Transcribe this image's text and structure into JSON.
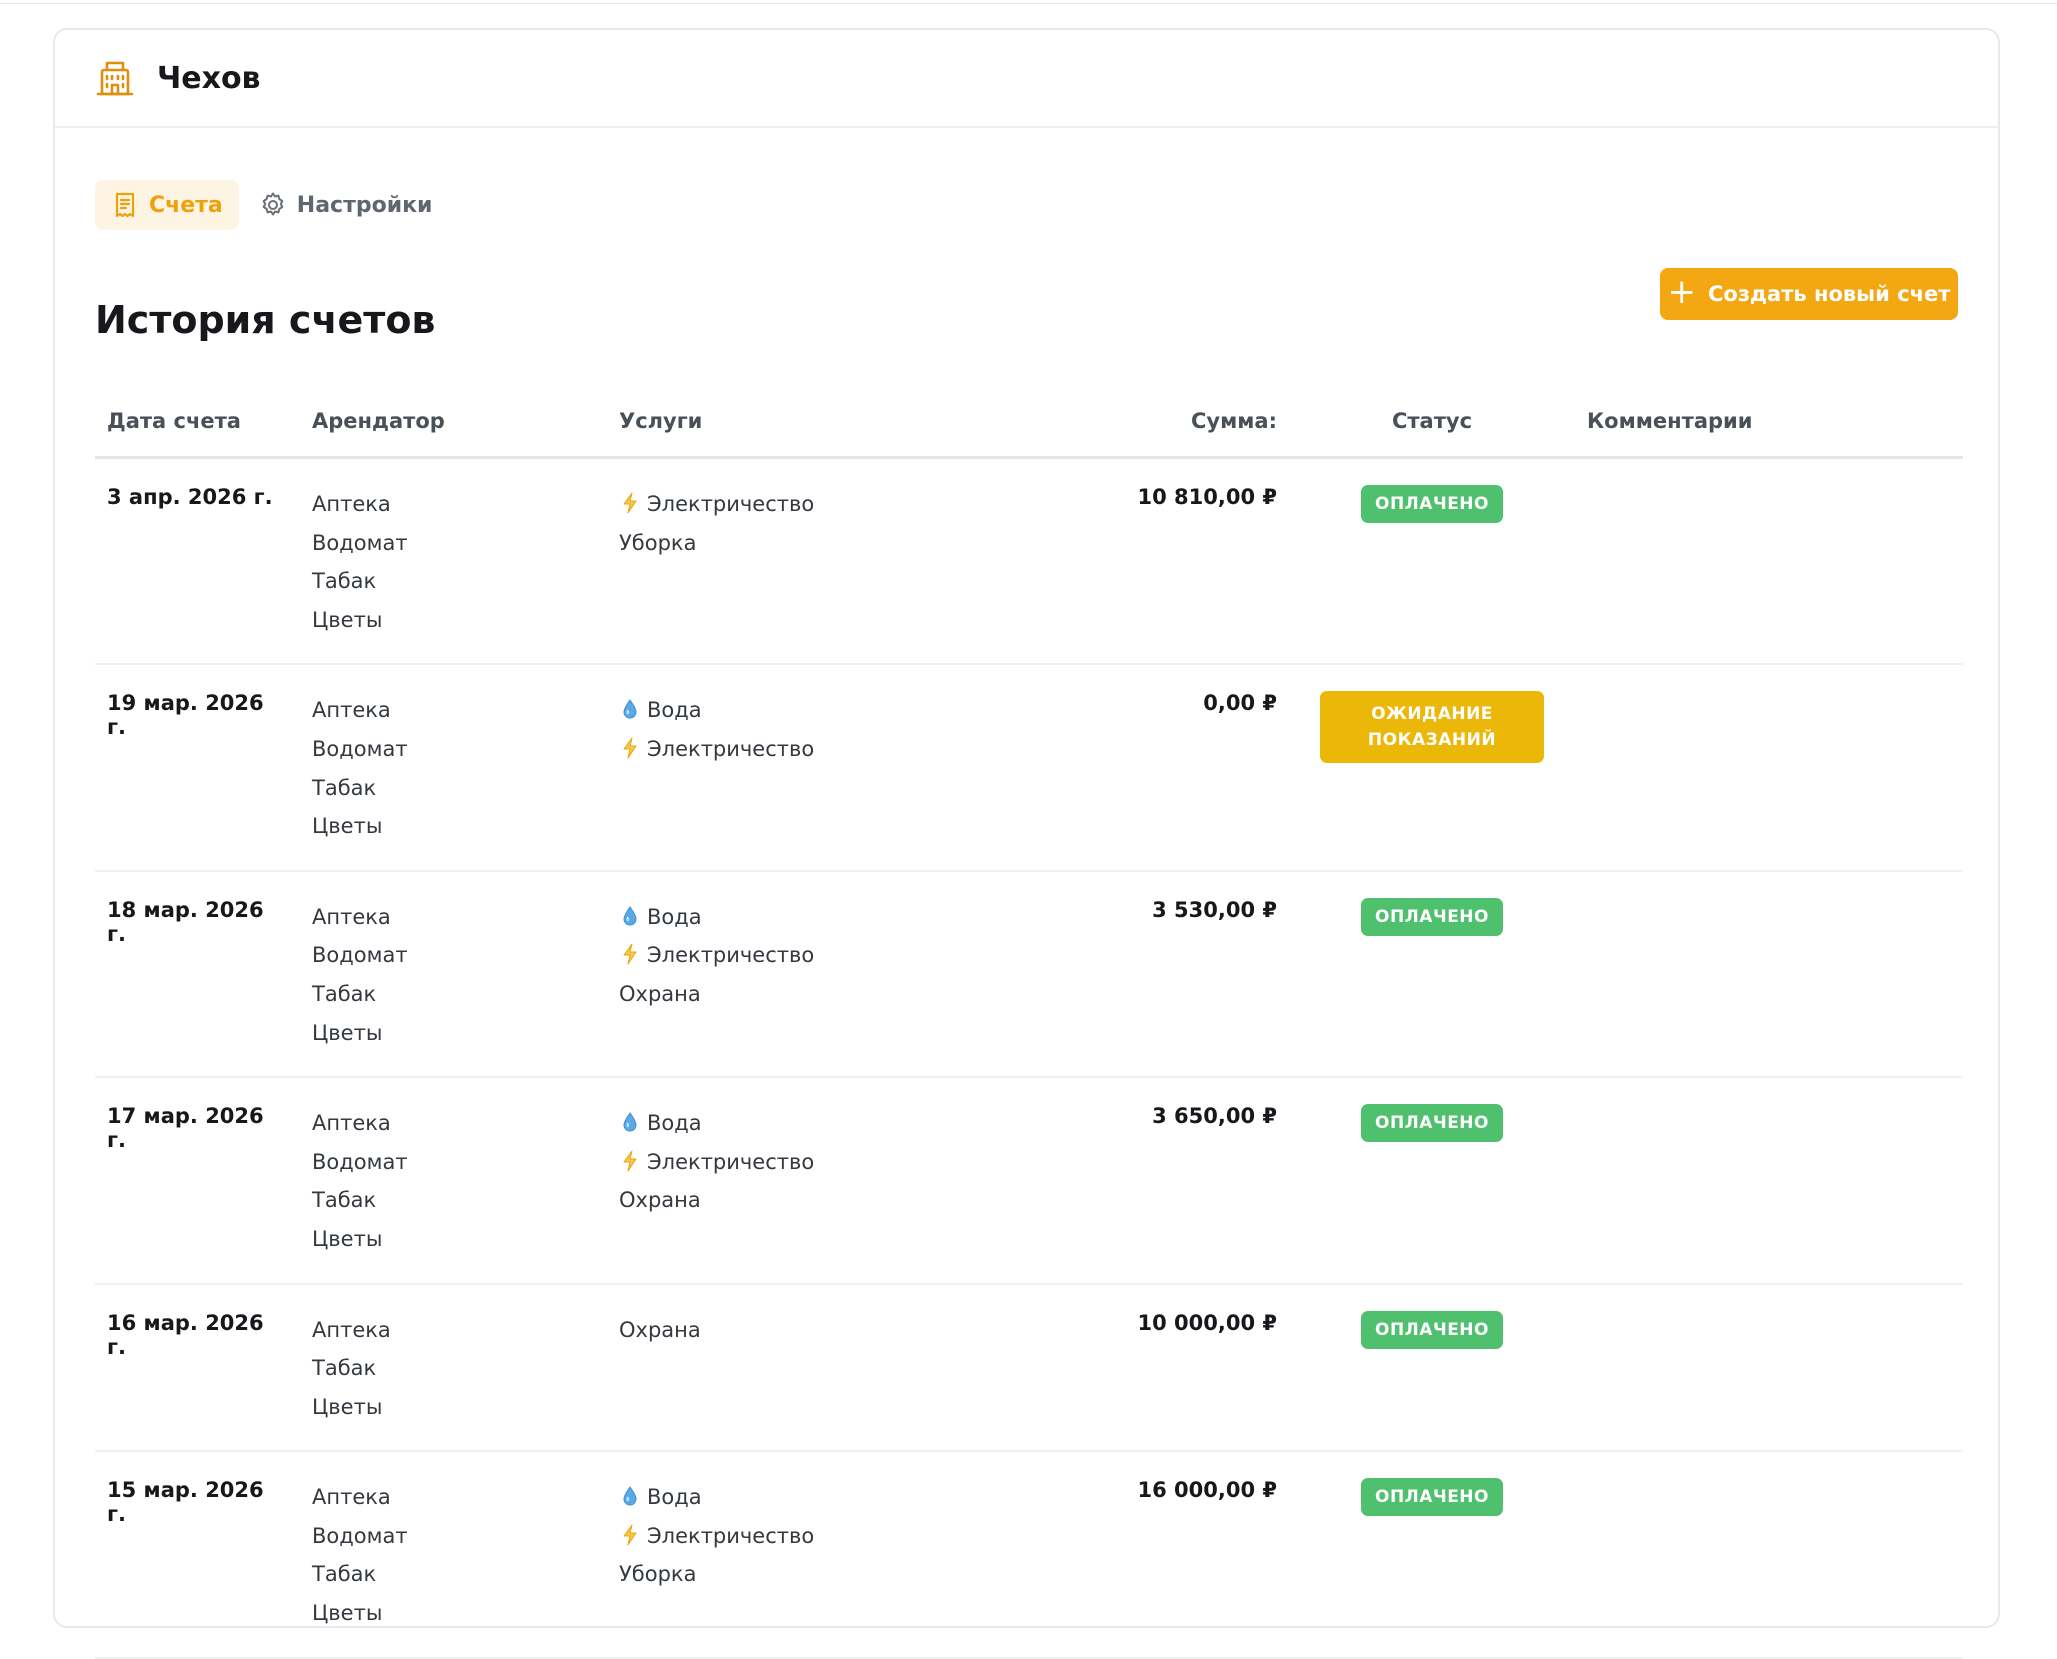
{
  "header": {
    "title": "Чехов",
    "icon": "building-icon"
  },
  "tabs": [
    {
      "label": "Счета",
      "icon": "receipt-icon",
      "active": true
    },
    {
      "label": "Настройки",
      "icon": "gear-icon",
      "active": false
    }
  ],
  "section": {
    "title": "История счетов"
  },
  "toolbar": {
    "create_label": "Создать новый счет",
    "create_icon": "plus-icon"
  },
  "colors": {
    "accent": "#f3a712",
    "paid": "#4fc06d",
    "pending": "#ebb80a"
  },
  "table": {
    "columns": [
      "Дата счета",
      "Арендатор",
      "Услуги",
      "Сумма:",
      "Статус",
      "Комментарии"
    ],
    "rows": [
      {
        "date": "3 апр. 2026 г.",
        "tenants": [
          "Аптека",
          "Водомат",
          "Табак",
          "Цветы"
        ],
        "services": [
          {
            "name": "Электричество",
            "icon": "lightning-icon"
          },
          {
            "name": "Уборка",
            "icon": ""
          }
        ],
        "amount": "10 810,00 ₽",
        "status": "ОПЛАЧЕНО",
        "status_type": "paid",
        "comment": ""
      },
      {
        "date": "19 мар. 2026 г.",
        "tenants": [
          "Аптека",
          "Водомат",
          "Табак",
          "Цветы"
        ],
        "services": [
          {
            "name": "Вода",
            "icon": "water-drop-icon"
          },
          {
            "name": "Электричество",
            "icon": "lightning-icon"
          }
        ],
        "amount": "0,00 ₽",
        "status": "ОЖИДАНИЕ ПОКАЗАНИЙ",
        "status_type": "pending",
        "comment": ""
      },
      {
        "date": "18 мар. 2026 г.",
        "tenants": [
          "Аптека",
          "Водомат",
          "Табак",
          "Цветы"
        ],
        "services": [
          {
            "name": "Вода",
            "icon": "water-drop-icon"
          },
          {
            "name": "Электричество",
            "icon": "lightning-icon"
          },
          {
            "name": "Охрана",
            "icon": ""
          }
        ],
        "amount": "3 530,00 ₽",
        "status": "ОПЛАЧЕНО",
        "status_type": "paid",
        "comment": ""
      },
      {
        "date": "17 мар. 2026 г.",
        "tenants": [
          "Аптека",
          "Водомат",
          "Табак",
          "Цветы"
        ],
        "services": [
          {
            "name": "Вода",
            "icon": "water-drop-icon"
          },
          {
            "name": "Электричество",
            "icon": "lightning-icon"
          },
          {
            "name": "Охрана",
            "icon": ""
          }
        ],
        "amount": "3 650,00 ₽",
        "status": "ОПЛАЧЕНО",
        "status_type": "paid",
        "comment": ""
      },
      {
        "date": "16 мар. 2026 г.",
        "tenants": [
          "Аптека",
          "Табак",
          "Цветы"
        ],
        "services": [
          {
            "name": "Охрана",
            "icon": ""
          }
        ],
        "amount": "10 000,00 ₽",
        "status": "ОПЛАЧЕНО",
        "status_type": "paid",
        "comment": ""
      },
      {
        "date": "15 мар. 2026 г.",
        "tenants": [
          "Аптека",
          "Водомат",
          "Табак",
          "Цветы"
        ],
        "services": [
          {
            "name": "Вода",
            "icon": "water-drop-icon"
          },
          {
            "name": "Электричество",
            "icon": "lightning-icon"
          },
          {
            "name": "Уборка",
            "icon": ""
          }
        ],
        "amount": "16 000,00 ₽",
        "status": "ОПЛАЧЕНО",
        "status_type": "paid",
        "comment": ""
      }
    ]
  }
}
